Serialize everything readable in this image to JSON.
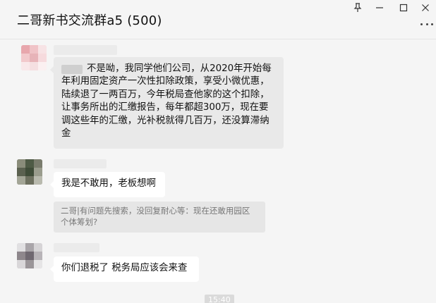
{
  "window": {
    "title": "二哥新书交流群a5 (500)",
    "controls": [
      "pin-icon",
      "minimize-icon",
      "maximize-icon",
      "close-icon"
    ],
    "more": "more-icon"
  },
  "messages": [
    {
      "text": "不是呦，我同学他们公司，从2020年开始每年利用固定资产一次性扣除政策，享受小微优惠，陆续退了一两百万，今年税局查他家的这个扣除，让事务所出的汇缴报告，每年都超300万，现在要调这些年的汇缴，光补税就得几百万，还没算滞纳金",
      "lines": [
        "不是呦，我同学他们公司，从2020年开始每",
        "年利用固定资产一次性扣除政策，享受小微优惠，",
        "陆续退了一两百万，今年税局查他家的这个扣除，",
        "让事务所出的汇缴报告，每年都超300万，现在要",
        "调这些年的汇缴，光补税就得几百万，还没算滞纳",
        "金"
      ]
    },
    {
      "text": "我是不敢用，老板想啊"
    },
    {
      "quote_lines": [
        "二哥|有问题先搜索，没回复耐心等：现在还敢用园区",
        "个体筹划?"
      ]
    },
    {
      "text": "你们退税了 税务局应该会来查"
    }
  ],
  "timestamp": "15:40",
  "colors": {
    "background": "#f5f5f5",
    "bubble_grey": "#e9e9e9",
    "bubble_white": "#ffffff",
    "quote_bg": "#e6e6e6"
  }
}
